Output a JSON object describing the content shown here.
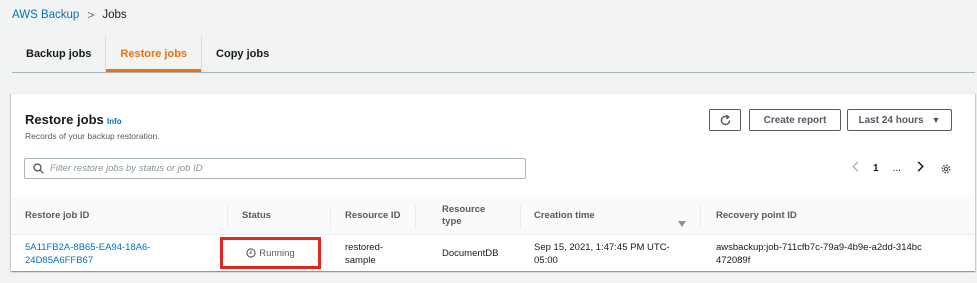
{
  "breadcrumb": {
    "root": "AWS Backup",
    "current": "Jobs"
  },
  "tabs": [
    {
      "label": "Backup jobs",
      "active": false
    },
    {
      "label": "Restore jobs",
      "active": true
    },
    {
      "label": "Copy jobs",
      "active": false
    }
  ],
  "panel": {
    "title": "Restore jobs",
    "info": "Info",
    "description": "Records of your backup restoration.",
    "refresh_icon": "refresh-icon",
    "create_report": "Create report",
    "time_range": "Last 24 hours",
    "search_placeholder": "Filter restore jobs by status or job ID",
    "page_current": "1",
    "page_more": "..."
  },
  "table": {
    "columns": [
      "Restore job ID",
      "Status",
      "Resource ID",
      "Resource type",
      "Creation time",
      "Recovery point ID"
    ],
    "sorted_column": "Creation time",
    "rows": [
      {
        "job_id": "5A11FB2A-8B65-EA94-18A6-24D85A6FFB67",
        "status": "Running",
        "resource_id": "restored-sample",
        "resource_type": "DocumentDB",
        "creation_time": "Sep 15, 2021, 1:47:45 PM UTC-05:00",
        "recovery_point_id": "awsbackup:job-711cfb7c-79a9-4b9e-a2dd-314bc472089f"
      }
    ]
  },
  "colors": {
    "link": "#0073bb",
    "accent": "#ec7211",
    "highlight": "#e3261f"
  }
}
